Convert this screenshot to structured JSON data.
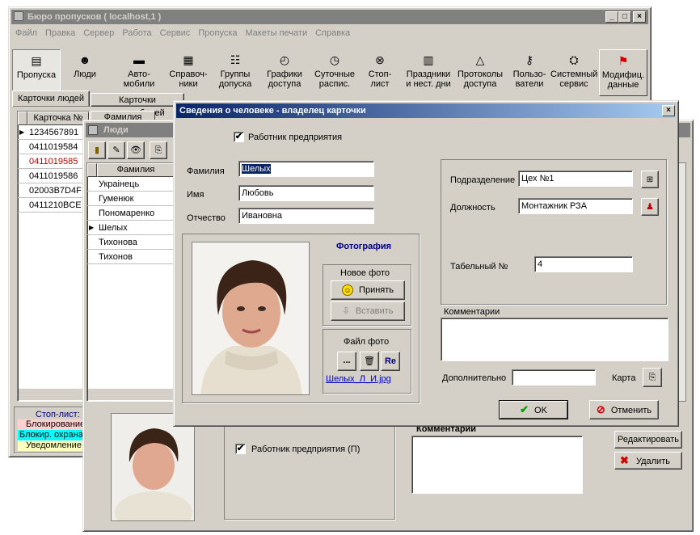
{
  "main_window": {
    "title": "Бюро пропусков ( localhost,1 )",
    "menu": [
      "Файл",
      "Правка",
      "Сервер",
      "Работа",
      "Сервис",
      "Пропуска",
      "Макеты печати",
      "Справка"
    ],
    "toolbar": [
      {
        "label": "Пропуска",
        "icon": "pass-icon"
      },
      {
        "label": "Люди",
        "icon": "people-icon"
      },
      {
        "label": "Авто-\nмобили",
        "icon": "car-icon"
      },
      {
        "label": "Справоч-\nники",
        "icon": "book-icon"
      },
      {
        "label": "Группы\nдопуска",
        "icon": "group-icon"
      },
      {
        "label": "Графики\nдоступа",
        "icon": "schedule-icon"
      },
      {
        "label": "Суточные\nраспис.",
        "icon": "clock-icon"
      },
      {
        "label": "Стоп-\nлист",
        "icon": "stop-icon"
      },
      {
        "label": "Праздники\nи нест. дни",
        "icon": "calendar-icon"
      },
      {
        "label": "Протоколы\nдоступа",
        "icon": "protocol-icon"
      },
      {
        "label": "Пользо-\nватели",
        "icon": "key-icon"
      },
      {
        "label": "Системный\nсервис",
        "icon": "service-icon"
      },
      {
        "label": "Модифиц.\nданные",
        "icon": "flag-icon"
      }
    ],
    "tabs": [
      "Карточки людей",
      "Карточки автомобилей"
    ],
    "cards_header": "Карточка №",
    "cards_header2": "Фамилия",
    "cards": [
      "1234567891",
      "0411019584",
      "0411019585",
      "0411019586",
      "02003B7D4F",
      "0411210BCE"
    ],
    "stop_list": {
      "title": "Стоп-лист:",
      "items": [
        "Блокирование",
        "Блокир. охрана",
        "Уведомление"
      ]
    }
  },
  "people_window": {
    "title": "Люди",
    "header": "Фамилия",
    "rows": [
      "Украінець",
      "Гуменюк",
      "Пономаренко",
      "Шелых",
      "Тихонова",
      "Тихонов"
    ]
  },
  "lower_panel": {
    "employee_label": "Работник предприятия  (П)",
    "comments_label": "Комментарии",
    "edit_button": "Редактировать",
    "delete_button": "Удалить"
  },
  "dialog": {
    "title": "Сведения о человеке - владелец карточки",
    "employee_label": "Работник предприятия",
    "last_name_label": "Фамилия",
    "last_name": "Шелых",
    "first_name_label": "Имя",
    "first_name": "Любовь",
    "patronymic_label": "Отчество",
    "patronymic": "Ивановна",
    "photo_title": "Фотография",
    "new_photo_label": "Новое фото",
    "accept_button": "Принять",
    "paste_button": "Вставить",
    "file_photo_label": "Файл фото",
    "browse_button": "...",
    "re_button": "Re",
    "file_name": "Шелых_Л_И.jpg",
    "department_label": "Подразделение",
    "department": "Цех №1",
    "position_label": "Должность",
    "position": "Монтажник РЗА",
    "tab_no_label": "Табельный №",
    "tab_no": "4",
    "comments_label": "Комментарии",
    "additional_label": "Дополнительно",
    "card_label": "Карта",
    "ok_button": "OK",
    "cancel_button": "Отменить"
  }
}
